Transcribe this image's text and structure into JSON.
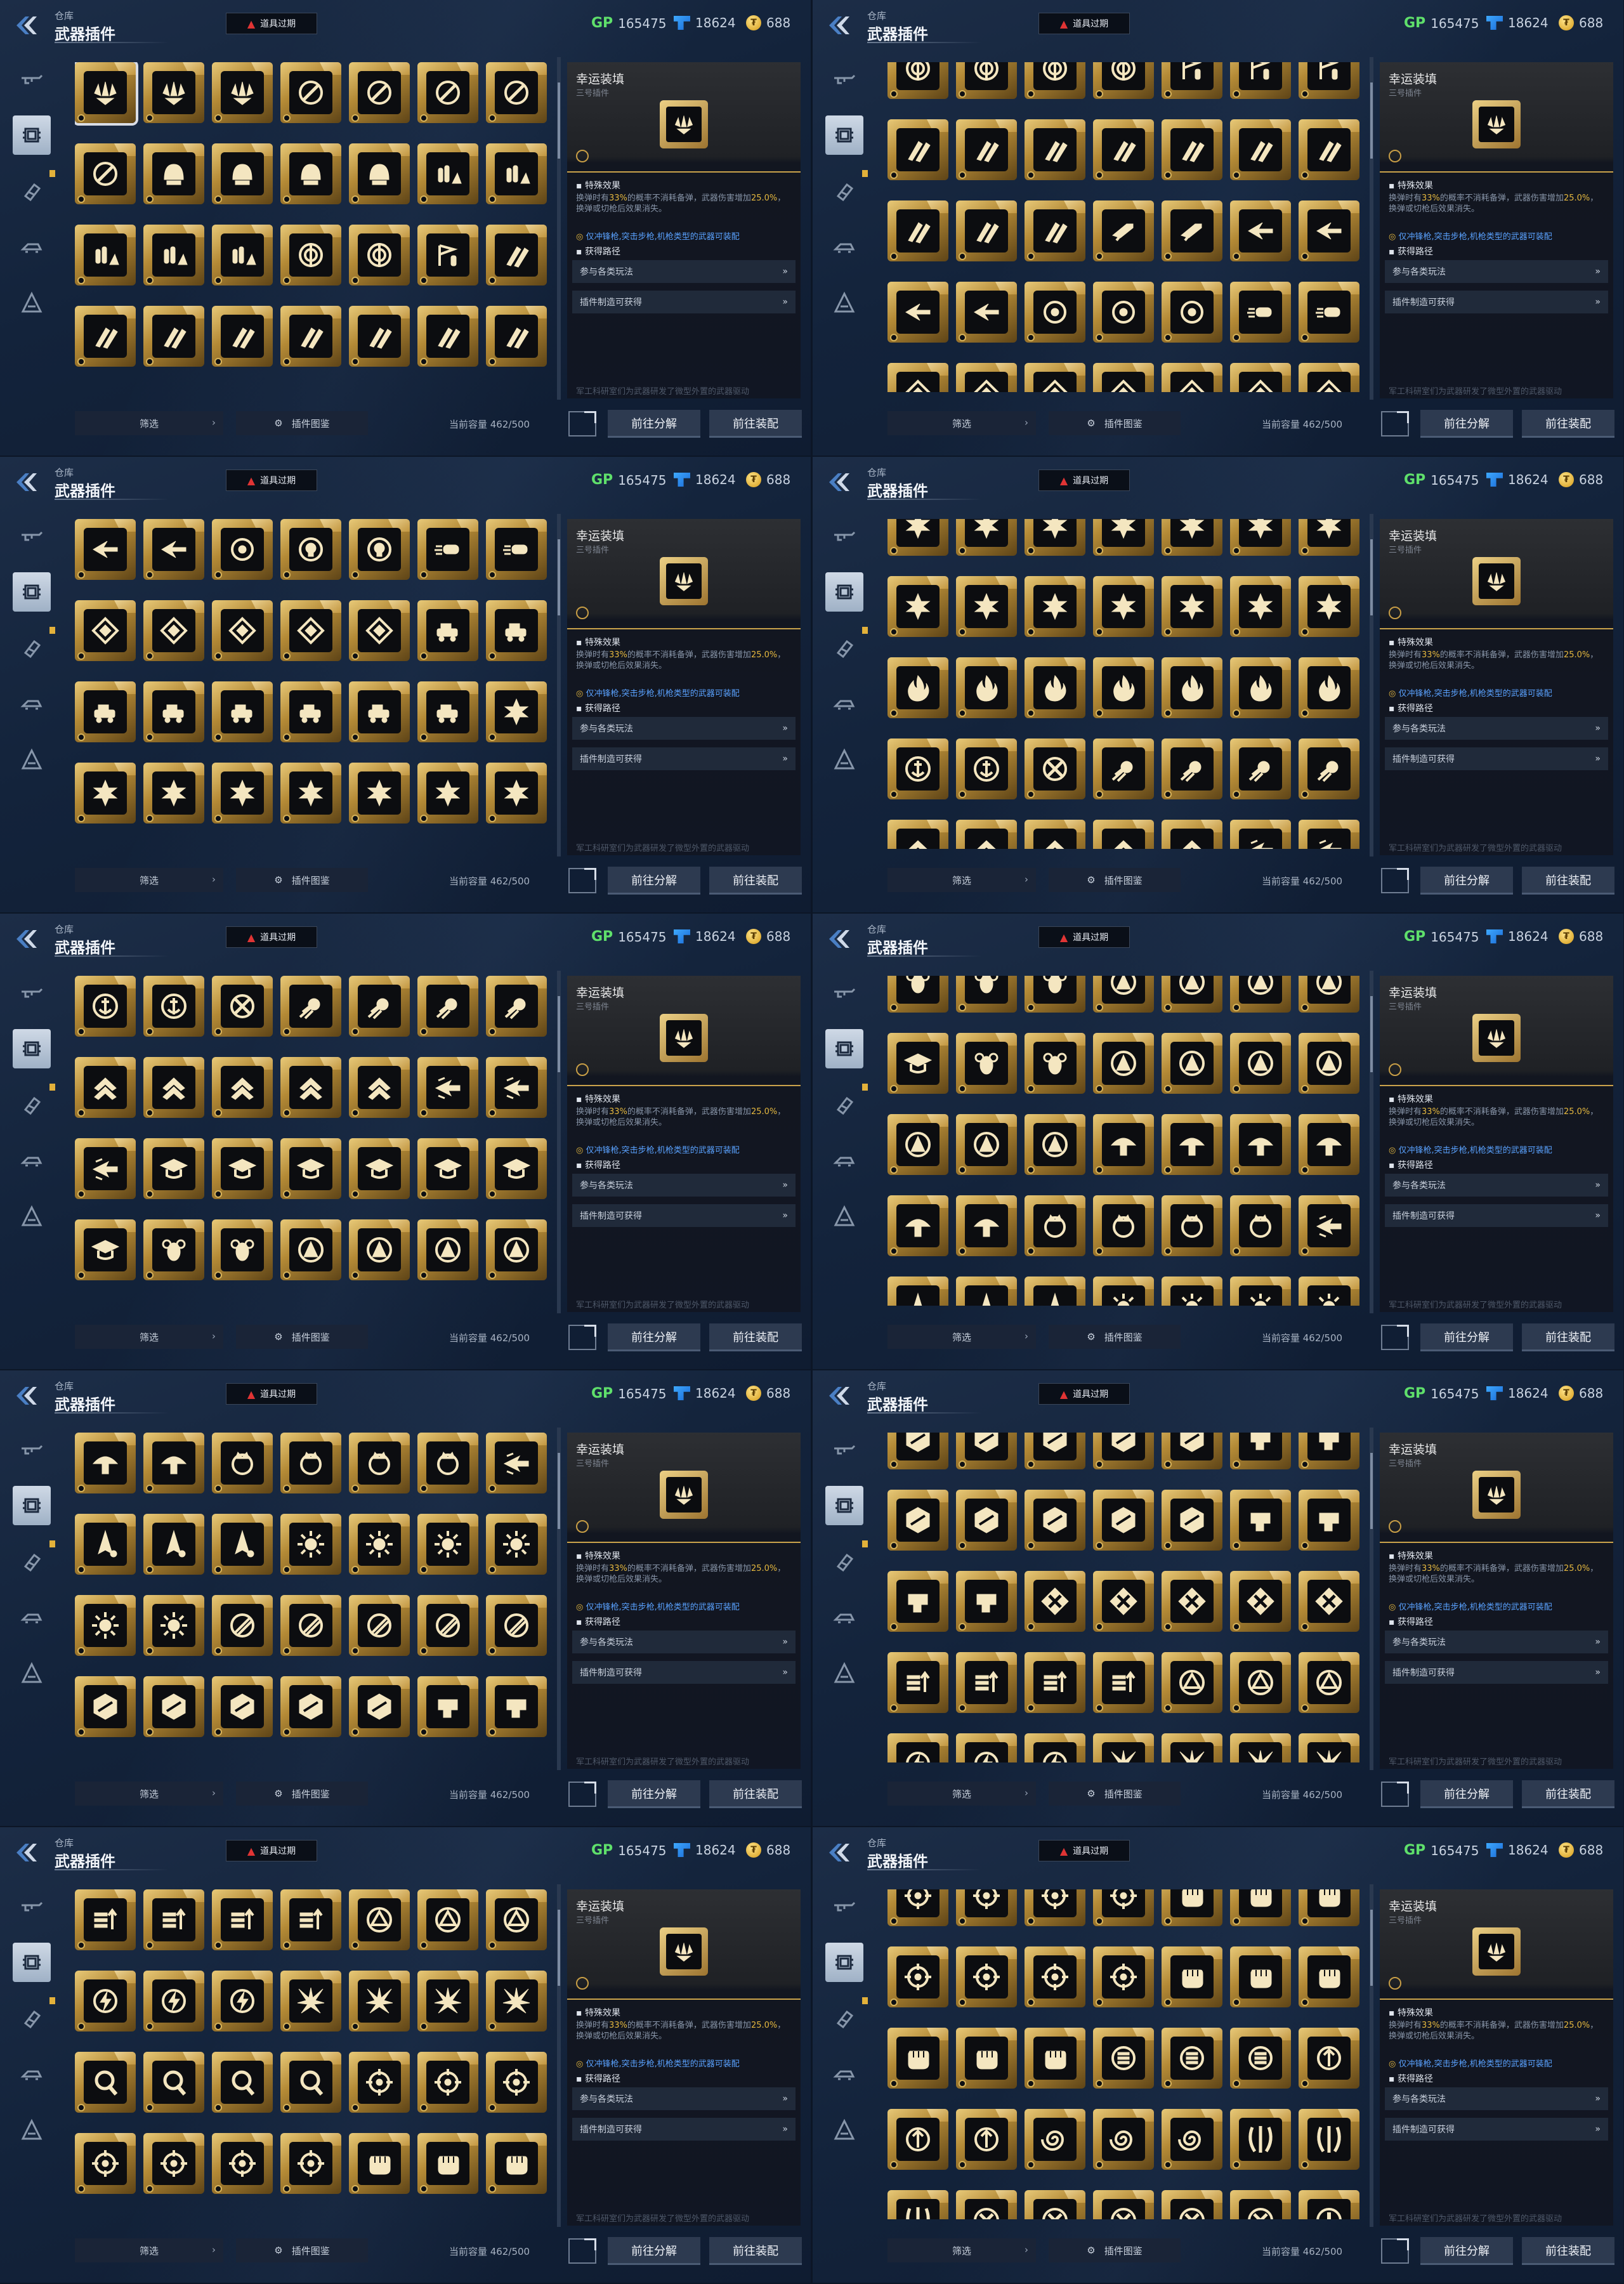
{
  "header": {
    "breadcrumb": "仓库",
    "title": "武器插件",
    "expire_label": "道具过期",
    "gp_label": "GP",
    "gp_value": "165475",
    "cube_value": "18624",
    "coin_value": "688"
  },
  "detail": {
    "name": "幸运装填",
    "subtitle": "三号插件",
    "effect_heading": "特殊效果",
    "effect_pre": "换弹时有",
    "effect_pct": "33%",
    "effect_mid": "的概率不消耗备弹，武器伤害增加",
    "effect_dmg": "25.0%",
    "effect_post": "，换弹或切枪后效果消失。",
    "restriction": "仅冲锋枪,突击步枪,机枪类型的武器可装配",
    "source_heading": "获得路径",
    "sources": [
      "参与各类玩法",
      "插件制造可获得"
    ],
    "footer": "军工科研室们为武器研发了微型外置的武器驱动"
  },
  "bottom": {
    "filter_label": "筛选",
    "atlas_label": "插件图鉴",
    "capacity": "当前容量 462/500",
    "disassemble": "前往分解",
    "equip": "前往装配"
  },
  "colors": {
    "background": "#13233b",
    "gold_frame": "#c89e46",
    "highlight": "#e5b83f",
    "restriction_blue": "#5aa2ff",
    "expire_warning": "#e03434"
  },
  "nav_icons": [
    "rifle-icon",
    "plugin-chip-icon",
    "attachment-icon",
    "vehicle-icon",
    "emblem-icon"
  ],
  "panels": [
    {
      "rows": [
        [
          "triple-blade",
          "triple-blade",
          "triple-blade",
          "slash-orb",
          "slash-orb",
          "slash-orb",
          "slash-orb"
        ],
        [
          "slash-orb",
          "helmet",
          "helmet",
          "helmet",
          "helmet",
          "bullets-triangle",
          "bullets-triangle"
        ],
        [
          "bullets-triangle",
          "bullets-triangle",
          "bullets-triangle",
          "target-orb",
          "target-orb",
          "flag-bullet",
          "twin-rocket"
        ],
        [
          "twin-rocket",
          "twin-rocket",
          "twin-rocket",
          "twin-rocket",
          "twin-rocket",
          "twin-rocket",
          "twin-rocket"
        ]
      ]
    },
    {
      "rows": [
        [
          "target-orb",
          "target-orb",
          "target-orb",
          "target-orb",
          "flag-bullet",
          "flag-bullet",
          "flag-bullet"
        ],
        [
          "twin-rocket",
          "twin-rocket",
          "twin-rocket",
          "twin-rocket",
          "twin-rocket",
          "twin-rocket",
          "twin-rocket"
        ],
        [
          "twin-rocket",
          "twin-rocket",
          "twin-rocket",
          "spark-rifle",
          "spark-rifle",
          "winged-shot",
          "winged-shot"
        ],
        [
          "winged-shot",
          "winged-shot",
          "ring-dot",
          "ring-dot",
          "ring-dot",
          "speed-bullet",
          "speed-bullet"
        ],
        [
          "diamond-shield",
          "diamond-shield",
          "diamond-shield",
          "diamond-shield",
          "diamond-shield",
          "diamond-shield",
          "diamond-shield"
        ]
      ]
    },
    {
      "rows": [
        [
          "winged-shot",
          "winged-shot",
          "ring-dot",
          "skull-ring",
          "skull-ring",
          "speed-bullet",
          "speed-bullet"
        ],
        [
          "diamond-shield",
          "diamond-shield",
          "diamond-shield",
          "diamond-shield",
          "diamond-shield",
          "armored-car",
          "armored-car"
        ],
        [
          "armored-car",
          "armored-car",
          "armored-car",
          "armored-car",
          "armored-car",
          "armored-car",
          "hex-star"
        ],
        [
          "hex-star",
          "hex-star",
          "hex-star",
          "hex-star",
          "hex-star",
          "hex-star",
          "hex-star"
        ]
      ]
    },
    {
      "rows": [
        [
          "hex-star",
          "hex-star",
          "hex-star",
          "hex-star",
          "hex-star",
          "hex-star",
          "hex-star"
        ],
        [
          "hex-star",
          "hex-star",
          "hex-star",
          "hex-star",
          "hex-star",
          "hex-star",
          "hex-star"
        ],
        [
          "flame",
          "flame",
          "flame",
          "flame",
          "flame",
          "flame",
          "flame"
        ],
        [
          "anchor",
          "anchor",
          "cross-shield",
          "comet",
          "comet",
          "comet",
          "comet"
        ],
        [
          "chevron-up",
          "chevron-up",
          "chevron-up",
          "chevron-up",
          "chevron-up",
          "winged-arrow",
          "winged-arrow"
        ]
      ]
    },
    {
      "rows": [
        [
          "anchor",
          "anchor",
          "cross-shield",
          "comet",
          "comet",
          "comet",
          "comet"
        ],
        [
          "chevron-up",
          "chevron-up",
          "chevron-up",
          "chevron-up",
          "chevron-up",
          "winged-arrow",
          "winged-arrow"
        ],
        [
          "winged-arrow",
          "grad-cap",
          "grad-cap",
          "grad-cap",
          "grad-cap",
          "grad-cap",
          "grad-cap"
        ],
        [
          "grad-cap",
          "bee",
          "bee",
          "tri-a",
          "tri-a",
          "tri-a",
          "tri-a"
        ]
      ]
    },
    {
      "rows": [
        [
          "bee",
          "bee",
          "bee",
          "tri-a",
          "tri-a",
          "tri-a",
          "tri-a"
        ],
        [
          "grad-cap",
          "bee",
          "bee",
          "tri-a",
          "tri-a",
          "tri-a",
          "tri-a"
        ],
        [
          "tri-a",
          "tri-a",
          "tri-a",
          "mushroom",
          "mushroom",
          "mushroom",
          "mushroom"
        ],
        [
          "mushroom",
          "mushroom",
          "crown-ring",
          "crown-ring",
          "crown-ring",
          "crown-ring",
          "winged-arrow"
        ],
        [
          "rocket-a",
          "rocket-a",
          "rocket-a",
          "sunburst",
          "sunburst",
          "sunburst",
          "sunburst"
        ]
      ]
    },
    {
      "rows": [
        [
          "mushroom",
          "mushroom",
          "crown-ring",
          "crown-ring",
          "crown-ring",
          "crown-ring",
          "winged-arrow"
        ],
        [
          "rocket-a",
          "rocket-a",
          "rocket-a",
          "sunburst",
          "sunburst",
          "sunburst",
          "sunburst"
        ],
        [
          "sunburst",
          "sunburst",
          "slash-ring",
          "slash-ring",
          "slash-ring",
          "slash-ring",
          "slash-ring"
        ],
        [
          "broken-hex",
          "broken-hex",
          "broken-hex",
          "broken-hex",
          "broken-hex",
          "fist-scroll",
          "fist-scroll"
        ]
      ]
    },
    {
      "rows": [
        [
          "broken-hex",
          "broken-hex",
          "broken-hex",
          "broken-hex",
          "broken-hex",
          "fist-scroll",
          "fist-scroll"
        ],
        [
          "broken-hex",
          "broken-hex",
          "broken-hex",
          "broken-hex",
          "broken-hex",
          "fist-scroll",
          "fist-scroll"
        ],
        [
          "fist-scroll",
          "fist-scroll",
          "cross-x",
          "cross-x",
          "cross-x",
          "cross-x",
          "cross-x"
        ],
        [
          "bars-up",
          "bars-up",
          "bars-up",
          "bars-up",
          "tri-circle",
          "tri-circle",
          "tri-circle"
        ],
        [
          "bolt-ring",
          "bolt-ring",
          "bolt-ring",
          "burst-x",
          "burst-x",
          "burst-x",
          "burst-x"
        ]
      ]
    },
    {
      "rows": [
        [
          "bars-up",
          "bars-up",
          "bars-up",
          "bars-up",
          "tri-circle",
          "tri-circle",
          "tri-circle"
        ],
        [
          "bolt-ring",
          "bolt-ring",
          "bolt-ring",
          "burst-x",
          "burst-x",
          "burst-x",
          "burst-x"
        ],
        [
          "hook-q",
          "hook-q",
          "hook-q",
          "hook-q",
          "crosshair",
          "crosshair",
          "crosshair"
        ],
        [
          "crosshair",
          "crosshair",
          "crosshair",
          "crosshair",
          "fist",
          "fist",
          "fist"
        ]
      ]
    },
    {
      "rows": [
        [
          "crosshair",
          "crosshair",
          "crosshair",
          "crosshair",
          "fist",
          "fist",
          "fist"
        ],
        [
          "crosshair",
          "crosshair",
          "crosshair",
          "crosshair",
          "fist",
          "fist",
          "fist"
        ],
        [
          "fist",
          "fist",
          "fist",
          "stack-e",
          "stack-e",
          "stack-e",
          "arrow-ring"
        ],
        [
          "arrow-ring",
          "arrow-ring",
          "swirl",
          "swirl",
          "swirl",
          "claw",
          "claw"
        ],
        [
          "claw",
          "x-mark",
          "x-mark",
          "x-mark",
          "x-mark",
          "x-mark",
          "dot-ring"
        ]
      ]
    }
  ]
}
